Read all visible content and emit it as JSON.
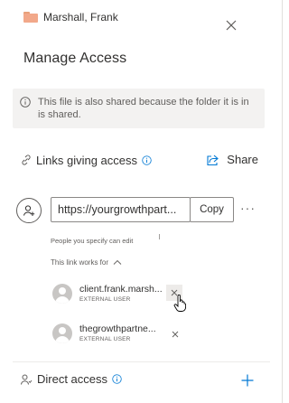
{
  "header": {
    "folder_name": "Marshall, Frank",
    "title": "Manage Access",
    "close_icon": "close-icon",
    "folder_icon": "folder-icon"
  },
  "info_banner": {
    "text": "This file is also shared because the folder it is in is shared.",
    "icon": "info-icon"
  },
  "links_section": {
    "label": "Links giving access",
    "share_label": "Share",
    "link": {
      "url": "https://yourgrowthpart...",
      "copy_label": "Copy",
      "more_label": "···",
      "permission_text": "People you specify can edit"
    },
    "works_for_label": "This link works for",
    "users": [
      {
        "name": "client.frank.marsh...",
        "type": "EXTERNAL USER"
      },
      {
        "name": "thegrowthpartne...",
        "type": "EXTERNAL USER"
      }
    ]
  },
  "direct_access": {
    "label": "Direct access",
    "add_icon": "plus-icon"
  },
  "colors": {
    "accent": "#0078d4",
    "folder": "#f2a88a",
    "banner_bg": "#f3f2f1",
    "text": "#323130",
    "secondary_text": "#605e5c"
  }
}
